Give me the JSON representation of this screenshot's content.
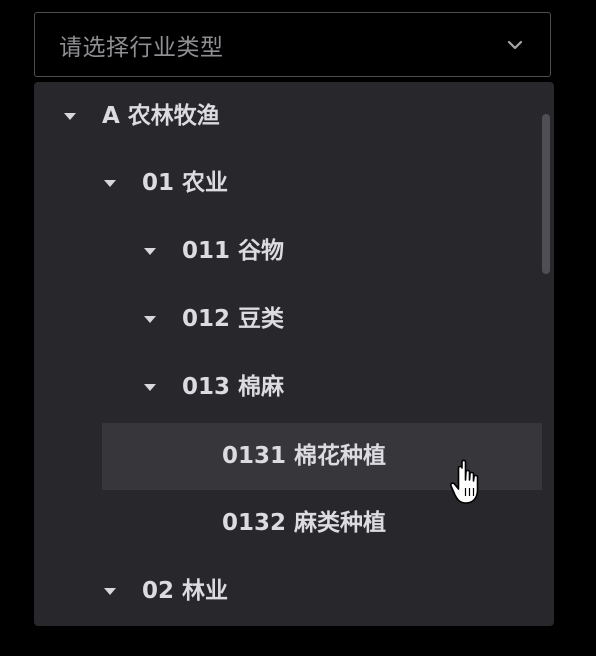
{
  "select": {
    "placeholder": "请选择行业类型"
  },
  "tree": {
    "items": [
      {
        "label": "A 农林牧渔",
        "expanded": true
      },
      {
        "label": "01 农业",
        "expanded": true
      },
      {
        "label": "011 谷物",
        "expanded": true
      },
      {
        "label": "012 豆类",
        "expanded": true
      },
      {
        "label": "013 棉麻",
        "expanded": true
      },
      {
        "label": "0131 棉花种植",
        "hovered": true
      },
      {
        "label": "0132 麻类种植"
      },
      {
        "label": "02 林业",
        "expanded": true
      }
    ]
  },
  "colors": {
    "background": "#000000",
    "panel": "#28282c",
    "hover": "#36363b",
    "text": "#dcdce0",
    "placeholder": "#8e8e93",
    "border": "#4d4d52"
  },
  "icons": {
    "dropdown": "chevron-down-icon",
    "tree_toggle": "caret-down-icon",
    "pointer": "hand-cursor-icon"
  }
}
